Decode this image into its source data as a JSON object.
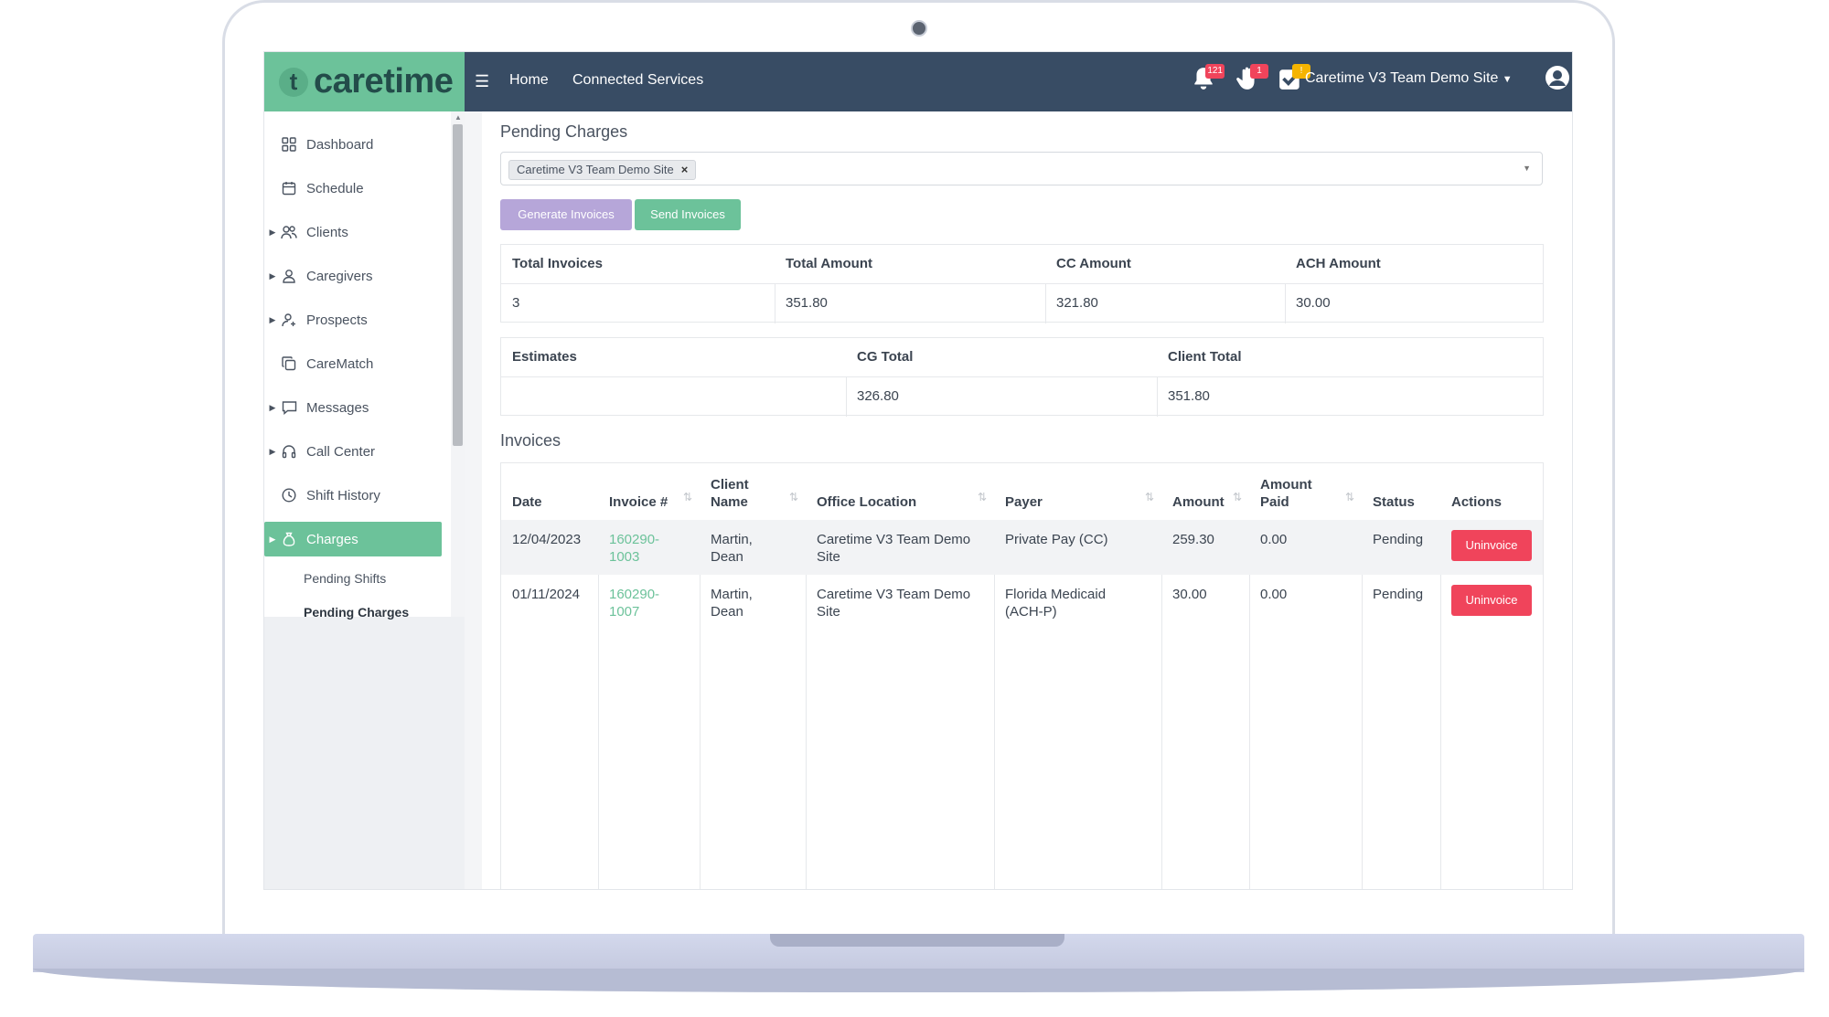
{
  "app": {
    "logo_text": "caretime",
    "logo_mark": "t"
  },
  "topbar": {
    "nav": {
      "home": "Home",
      "connected_services": "Connected Services"
    },
    "notifications_count": "121",
    "requests_count": "1",
    "tasks_count": "!",
    "site_name": "Caretime V3 Team Demo Site"
  },
  "sidebar": {
    "items": [
      {
        "label": "Dashboard",
        "icon": "dashboard-icon",
        "has_caret": false
      },
      {
        "label": "Schedule",
        "icon": "calendar-icon",
        "has_caret": false
      },
      {
        "label": "Clients",
        "icon": "users-icon",
        "has_caret": true
      },
      {
        "label": "Caregivers",
        "icon": "user-icon",
        "has_caret": true
      },
      {
        "label": "Prospects",
        "icon": "user-add-icon",
        "has_caret": true
      },
      {
        "label": "CareMatch",
        "icon": "copy-icon",
        "has_caret": false
      },
      {
        "label": "Messages",
        "icon": "message-icon",
        "has_caret": true
      },
      {
        "label": "Call Center",
        "icon": "headset-icon",
        "has_caret": true
      },
      {
        "label": "Shift History",
        "icon": "clock-icon",
        "has_caret": false
      },
      {
        "label": "Charges",
        "icon": "money-bag-icon",
        "has_caret": true,
        "active": true
      }
    ],
    "sub_items": [
      {
        "label": "Pending Shifts"
      },
      {
        "label": "Pending Charges",
        "active": true
      }
    ]
  },
  "main": {
    "title": "Pending Charges",
    "site_filter_chip": "Caretime V3 Team Demo Site",
    "buttons": {
      "generate": "Generate Invoices",
      "send": "Send Invoices"
    },
    "summary": {
      "headers": [
        "Total Invoices",
        "Total Amount",
        "CC Amount",
        "ACH Amount"
      ],
      "values": [
        "3",
        "351.80",
        "321.80",
        "30.00"
      ]
    },
    "estimates": {
      "headers": [
        "Estimates",
        "CG Total",
        "Client Total"
      ],
      "values": [
        "",
        "326.80",
        "351.80"
      ]
    },
    "invoices_title": "Invoices",
    "invoices": {
      "columns": [
        "Date",
        "Invoice #",
        "Client Name",
        "Office Location",
        "Payer",
        "Amount",
        "Amount Paid",
        "Status",
        "Actions"
      ],
      "rows": [
        {
          "date": "12/04/2023",
          "invoice": "160290-1003",
          "client": "Martin, Dean",
          "office": "Caretime V3 Team Demo Site",
          "payer": "Private Pay (CC)",
          "amount": "259.30",
          "paid": "0.00",
          "status": "Pending",
          "action": "Uninvoice"
        },
        {
          "date": "01/11/2024",
          "invoice": "160290-1007",
          "client": "Martin, Dean",
          "office": "Caretime V3 Team Demo Site",
          "payer": "Florida Medicaid (ACH-P)",
          "amount": "30.00",
          "paid": "0.00",
          "status": "Pending",
          "action": "Uninvoice"
        }
      ]
    }
  },
  "colors": {
    "brand_green": "#6cc29a",
    "topbar": "#384c64",
    "danger": "#f0445b",
    "purple": "#b6a6d9"
  }
}
